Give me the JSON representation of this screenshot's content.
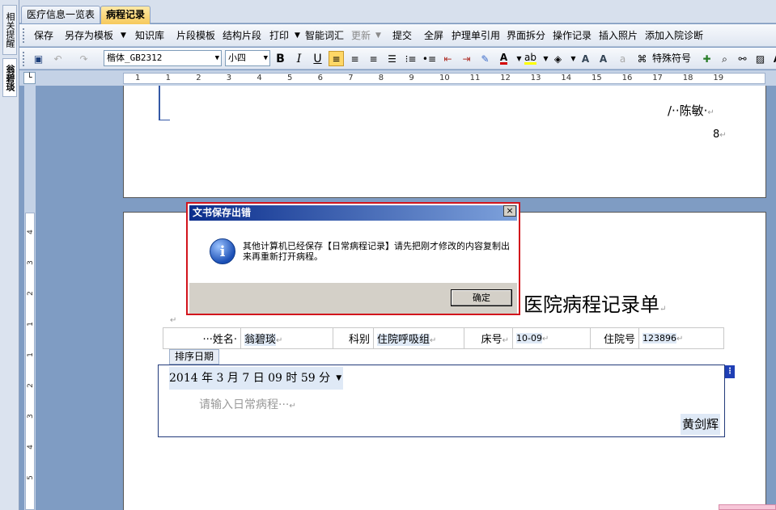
{
  "left_panel": {
    "tab_reminder": "相关提醒",
    "patient_tab": "翁碧琰"
  },
  "tabs": [
    {
      "label": "医疗信息一览表"
    },
    {
      "label": "病程记录"
    }
  ],
  "toolbar1": {
    "save": "保存",
    "save_as_template": "另存为模板",
    "knowledge_base": "知识库",
    "fragment_template": "片段模板",
    "structured_fragment": "结构片段",
    "print": "打印",
    "smart_words": "智能词汇",
    "update": "更新",
    "submit": "提交",
    "fullscreen": "全屏",
    "nursing_ref": "护理单引用",
    "split_view": "界面拆分",
    "operation_log": "操作记录",
    "insert_photo": "插入照片",
    "add_admission_dx": "添加入院诊断"
  },
  "toolbar2": {
    "font_name": "楷体_GB2312",
    "font_size": "小四",
    "special_symbol": "特殊符号",
    "font_color": "#d40000",
    "highlight_color": "#ffff00"
  },
  "ruler": {
    "h_numbers": [
      "1",
      "1",
      "2",
      "3",
      "4",
      "5",
      "6",
      "7",
      "8",
      "9",
      "10",
      "11",
      "12",
      "13",
      "14",
      "15",
      "16",
      "17",
      "18",
      "19"
    ],
    "v_numbers": [
      "4",
      "3",
      "2",
      "1",
      "1",
      "2",
      "3",
      "4",
      "5"
    ]
  },
  "prev_page": {
    "signature": "/··陈敏·",
    "page_number": "8"
  },
  "dialog": {
    "title": "文书保存出错",
    "close": "×",
    "message": "其他计算机已经保存【日常病程记录】请先把刚才修改的内容复制出来再重新打开病程。",
    "ok_button": "确定"
  },
  "record": {
    "heading": "医院病程记录单",
    "name_label": "···姓名·",
    "name_value": "翁碧琰",
    "dept_label": "科别",
    "dept_value": "住院呼吸组",
    "bed_label": "床号",
    "bed_value": "10-09",
    "admission_label": "住院号",
    "admission_value": "123896",
    "date_tab": "排序日期",
    "date_value": "2014 年 3 月 7 日 09 时 59 分",
    "placeholder": "请输入日常病程···",
    "doctor": "黄剑辉"
  }
}
